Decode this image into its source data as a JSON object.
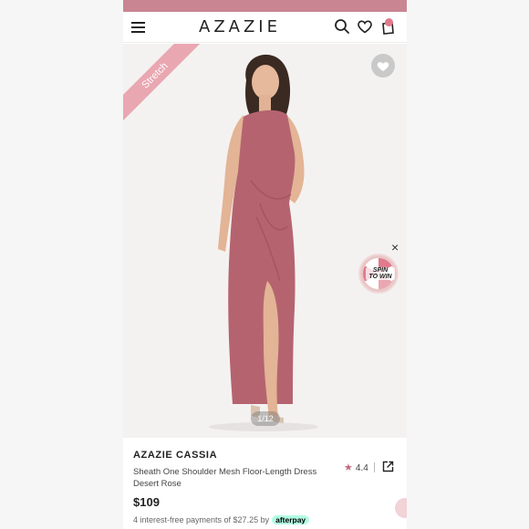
{
  "header": {
    "logo": "AZAZIE",
    "menu_icon": "hamburger-icon",
    "search_icon": "search-icon",
    "wishlist_icon": "heart-icon",
    "cart_icon": "shopping-bag-icon"
  },
  "hero": {
    "ribbon_label": "Stretch",
    "favorite_icon": "heart-icon",
    "spin_label_1": "SPIN",
    "spin_label_2": "TO WIN",
    "close_glyph": "×",
    "image_counter": "1/12"
  },
  "product": {
    "brand": "AZAZIE CASSIA",
    "name": "Sheath One Shoulder Mesh Floor-Length Dress",
    "color": "Desert Rose",
    "rating": "4.4",
    "price": "$109",
    "installments_text": "4 interest-free payments of $27.25 by",
    "afterpay_label": "afterpay"
  },
  "colors": {
    "accent": "#c98592",
    "ribbon": "#e9a7b1",
    "dress": "#b5646f"
  }
}
